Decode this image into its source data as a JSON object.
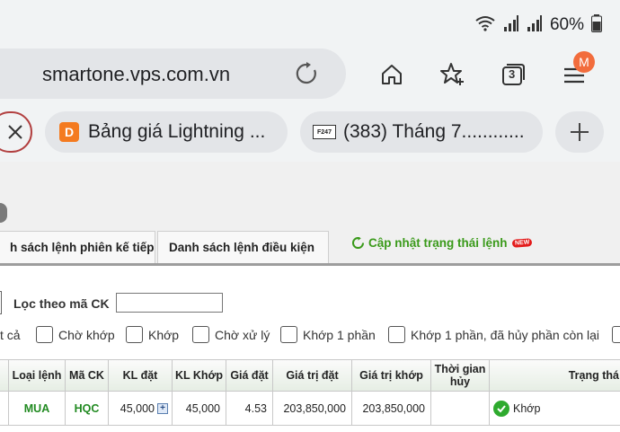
{
  "status_bar": {
    "battery_percent": "60%",
    "icons": [
      "wifi-icon",
      "signal-icon",
      "signal-icon",
      "battery-icon"
    ]
  },
  "browser": {
    "url": "smartone.vps.com.vn",
    "tab_count": "3",
    "avatar_letter": "M",
    "accent_color": "#f26c3c",
    "tabs": [
      {
        "title": "Bảng giá Lightning ...",
        "favicon_letter": "D",
        "favicon_color": "#f47b20"
      },
      {
        "title": "(383) Tháng 7............",
        "favicon_letter": "F247"
      }
    ]
  },
  "order_page": {
    "sub_tabs": [
      "h sách lệnh phiên kế tiếp",
      "Danh sách lệnh điều kiện"
    ],
    "update_link": "Cập nhật trạng thái lệnh",
    "new_badge": "NEW",
    "filter_label": "Lọc theo mã CK",
    "filter_value": "",
    "checkboxes": [
      {
        "label": "t cả",
        "checked": false
      },
      {
        "label": "Chờ khớp",
        "checked": false
      },
      {
        "label": "Khớp",
        "checked": false
      },
      {
        "label": "Chờ xử lý",
        "checked": false
      },
      {
        "label": "Khớp 1 phần",
        "checked": false
      },
      {
        "label": "Khớp 1 phần, đã hủy phần còn lại",
        "checked": false
      }
    ],
    "table": {
      "headers": [
        "",
        "Loại lệnh",
        "Mã CK",
        "KL đặt",
        "KL Khớp",
        "Giá đặt",
        "Giá trị đặt",
        "Giá trị khớp",
        "Thời gian hủy",
        "Trạng thá"
      ],
      "rows": [
        [
          "",
          "MUA",
          "HQC",
          "45,000",
          "45,000",
          "4.53",
          "203,850,000",
          "203,850,000",
          "",
          "Khớp"
        ]
      ]
    }
  }
}
